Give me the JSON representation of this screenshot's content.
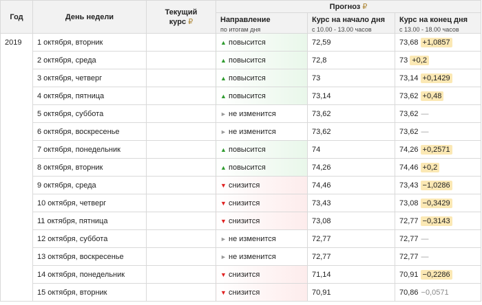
{
  "header": {
    "year": "Год",
    "day": "День недели",
    "current_line1": "Текущий",
    "current_line2": "курс",
    "forecast": "Прогноз",
    "direction": "Направление",
    "direction_sub": "по итогам дня",
    "open": "Курс на начало дня",
    "open_sub": "с 10.00 - 13.00 часов",
    "close": "Курс на конец дня",
    "close_sub": "с 13.00 - 18.00 часов",
    "currency_symbol": "₽"
  },
  "year": "2019",
  "rows": [
    {
      "day": "1 октября, вторник",
      "current": "",
      "dir": "up",
      "dir_label": "повысится",
      "open": "72,59",
      "close": "73,68",
      "change": "+1,0857",
      "change_type": "pos"
    },
    {
      "day": "2 октября, среда",
      "current": "",
      "dir": "up",
      "dir_label": "повысится",
      "open": "72,8",
      "close": "73",
      "change": "+0,2",
      "change_type": "pos"
    },
    {
      "day": "3 октября, четверг",
      "current": "",
      "dir": "up",
      "dir_label": "повысится",
      "open": "73",
      "close": "73,14",
      "change": "+0,1429",
      "change_type": "pos"
    },
    {
      "day": "4 октября, пятница",
      "current": "",
      "dir": "up",
      "dir_label": "повысится",
      "open": "73,14",
      "close": "73,62",
      "change": "+0,48",
      "change_type": "pos"
    },
    {
      "day": "5 октября, суббота",
      "current": "",
      "dir": "flat",
      "dir_label": "не изменится",
      "open": "73,62",
      "close": "73,62",
      "change": "—",
      "change_type": "zero"
    },
    {
      "day": "6 октября, воскресенье",
      "current": "",
      "dir": "flat",
      "dir_label": "не изменится",
      "open": "73,62",
      "close": "73,62",
      "change": "—",
      "change_type": "zero"
    },
    {
      "day": "7 октября, понедельник",
      "current": "",
      "dir": "up",
      "dir_label": "повысится",
      "open": "74",
      "close": "74,26",
      "change": "+0,2571",
      "change_type": "pos"
    },
    {
      "day": "8 октября, вторник",
      "current": "",
      "dir": "up",
      "dir_label": "повысится",
      "open": "74,26",
      "close": "74,46",
      "change": "+0,2",
      "change_type": "pos"
    },
    {
      "day": "9 октября, среда",
      "current": "",
      "dir": "down",
      "dir_label": "снизится",
      "open": "74,46",
      "close": "73,43",
      "change": "−1,0286",
      "change_type": "neg"
    },
    {
      "day": "10 октября, четверг",
      "current": "",
      "dir": "down",
      "dir_label": "снизится",
      "open": "73,43",
      "close": "73,08",
      "change": "−0,3429",
      "change_type": "neg"
    },
    {
      "day": "11 октября, пятница",
      "current": "",
      "dir": "down",
      "dir_label": "снизится",
      "open": "73,08",
      "close": "72,77",
      "change": "−0,3143",
      "change_type": "neg"
    },
    {
      "day": "12 октября, суббота",
      "current": "",
      "dir": "flat",
      "dir_label": "не изменится",
      "open": "72,77",
      "close": "72,77",
      "change": "—",
      "change_type": "zero"
    },
    {
      "day": "13 октября, воскресенье",
      "current": "",
      "dir": "flat",
      "dir_label": "не изменится",
      "open": "72,77",
      "close": "72,77",
      "change": "—",
      "change_type": "zero"
    },
    {
      "day": "14 октября, понедельник",
      "current": "",
      "dir": "down",
      "dir_label": "снизится",
      "open": "71,14",
      "close": "70,91",
      "change": "−0,2286",
      "change_type": "neg"
    },
    {
      "day": "15 октября, вторник",
      "current": "",
      "dir": "down",
      "dir_label": "снизится",
      "open": "70,91",
      "close": "70,86",
      "change": "−0,0571",
      "change_type": "faint"
    }
  ],
  "colors": {
    "up": "#2e9b2e",
    "down": "#e02020",
    "flat": "#9a9a9a",
    "highlight": "#fbe8b4"
  }
}
